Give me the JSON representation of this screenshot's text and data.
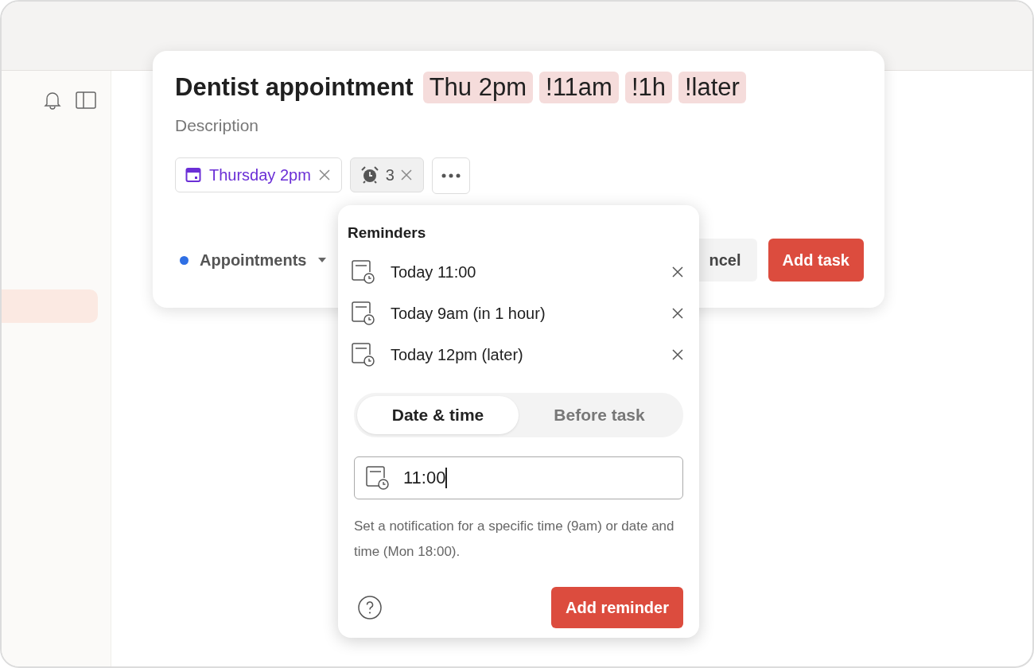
{
  "sidebar": {
    "items": [
      {
        "selected": true
      }
    ]
  },
  "task": {
    "title": "Dentist appointment",
    "tokens": [
      "Thu 2pm",
      "!11am",
      "!1h",
      "!later"
    ],
    "description_placeholder": "Description",
    "date_chip": {
      "label": "Thursday 2pm"
    },
    "reminder_chip": {
      "label": "3"
    },
    "project": {
      "name": "Appointments",
      "color": "#2f6fe4"
    },
    "buttons": {
      "cancel": "ncel",
      "add": "Add task"
    }
  },
  "reminders_popover": {
    "title": "Reminders",
    "reminders": [
      {
        "label": "Today 11:00"
      },
      {
        "label": "Today 9am (in 1 hour)"
      },
      {
        "label": "Today 12pm (later)"
      }
    ],
    "tabs": [
      {
        "label": "Date & time",
        "selected": true
      },
      {
        "label": "Before task",
        "selected": false
      }
    ],
    "time_input": {
      "value": "11:00"
    },
    "hint": "Set a notification for a specific time (9am) or date and time (Mon 18:00).",
    "add_button": "Add reminder"
  }
}
